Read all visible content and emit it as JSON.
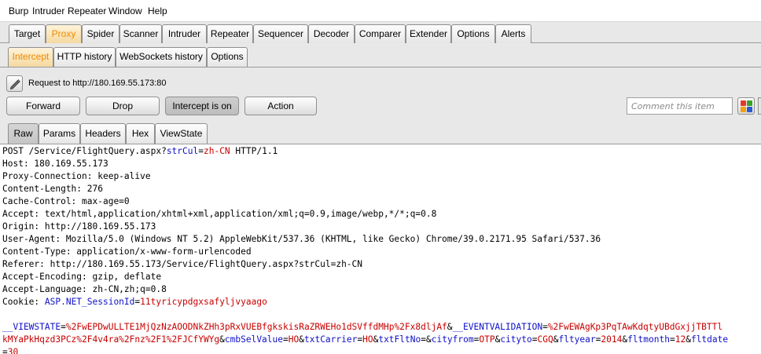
{
  "menu": [
    "Burp",
    "Intruder",
    "Repeater",
    "Window",
    "Help"
  ],
  "main_tabs": [
    "Target",
    "Proxy",
    "Spider",
    "Scanner",
    "Intruder",
    "Repeater",
    "Sequencer",
    "Decoder",
    "Comparer",
    "Extender",
    "Options",
    "Alerts"
  ],
  "main_tab_active": "Proxy",
  "proxy_tabs": [
    "Intercept",
    "HTTP history",
    "WebSockets history",
    "Options"
  ],
  "proxy_tab_active": "Intercept",
  "intercept": {
    "request_label": "Request to http://180.169.55.173:80",
    "forward_label": "Forward",
    "drop_label": "Drop",
    "intercept_label": "Intercept is on",
    "action_label": "Action",
    "comment_placeholder": "Comment this item"
  },
  "view_tabs": [
    "Raw",
    "Params",
    "Headers",
    "Hex",
    "ViewState"
  ],
  "view_tab_active": "Raw",
  "colors": {
    "accent_orange": "#f08a00",
    "param_blue": "#1010c8",
    "value_red": "#c80000"
  },
  "request": {
    "method_line": {
      "prefix": "POST /Service/FlightQuery.aspx?",
      "param": "strCul",
      "eq": "=",
      "value": "zh-CN",
      "suffix": " HTTP/1.1"
    },
    "headers": [
      "Host: 180.169.55.173",
      "Proxy-Connection: keep-alive",
      "Content-Length: 276",
      "Cache-Control: max-age=0",
      "Accept: text/html,application/xhtml+xml,application/xml;q=0.9,image/webp,*/*;q=0.8",
      "Origin: http://180.169.55.173",
      "User-Agent: Mozilla/5.0 (Windows NT 5.2) AppleWebKit/537.36 (KHTML, like Gecko) Chrome/39.0.2171.95 Safari/537.36",
      "Content-Type: application/x-www-form-urlencoded",
      "Referer: http://180.169.55.173/Service/FlightQuery.aspx?strCul=zh-CN",
      "Accept-Encoding: gzip, deflate",
      "Accept-Language: zh-CN,zh;q=0.8"
    ],
    "cookie": {
      "prefix": "Cookie: ",
      "name": "ASP.NET_SessionId",
      "eq": "=",
      "value": "11tyricypdgxsafyljvyaago"
    },
    "body_lines": [
      [
        {
          "t": "__VIEWSTATE",
          "c": "b"
        },
        {
          "t": "=",
          "c": "k"
        },
        {
          "t": "%2FwEPDwULLTE1MjQzNzAOODNkZHh3pRxVUEBfgkskisRaZRWEHo1dSVffdMHp%2Fx8dljAf",
          "c": "r"
        },
        {
          "t": "&",
          "c": "k"
        },
        {
          "t": "__EVENTVALIDATION",
          "c": "b"
        },
        {
          "t": "=",
          "c": "k"
        },
        {
          "t": "%2FwEWAgKp3PqTAwKdqtyUBdGxjjTBTTl",
          "c": "r"
        }
      ],
      [
        {
          "t": "kMYaPkHqzd3PCz%2F4v4ra%2Fnz%2F1%2FJCfYWYg",
          "c": "r"
        },
        {
          "t": "&",
          "c": "k"
        },
        {
          "t": "cmbSelValue",
          "c": "b"
        },
        {
          "t": "=",
          "c": "k"
        },
        {
          "t": "HO",
          "c": "r"
        },
        {
          "t": "&",
          "c": "k"
        },
        {
          "t": "txtCarrier",
          "c": "b"
        },
        {
          "t": "=",
          "c": "k"
        },
        {
          "t": "HO",
          "c": "r"
        },
        {
          "t": "&",
          "c": "k"
        },
        {
          "t": "txtFltNo",
          "c": "b"
        },
        {
          "t": "=",
          "c": "k"
        },
        {
          "t": "&",
          "c": "k"
        },
        {
          "t": "cityfrom",
          "c": "b"
        },
        {
          "t": "=",
          "c": "k"
        },
        {
          "t": "OTP",
          "c": "r"
        },
        {
          "t": "&",
          "c": "k"
        },
        {
          "t": "cityto",
          "c": "b"
        },
        {
          "t": "=",
          "c": "k"
        },
        {
          "t": "CGQ",
          "c": "r"
        },
        {
          "t": "&",
          "c": "k"
        },
        {
          "t": "fltyear",
          "c": "b"
        },
        {
          "t": "=",
          "c": "k"
        },
        {
          "t": "2014",
          "c": "r"
        },
        {
          "t": "&",
          "c": "k"
        },
        {
          "t": "fltmonth",
          "c": "b"
        },
        {
          "t": "=",
          "c": "k"
        },
        {
          "t": "12",
          "c": "r"
        },
        {
          "t": "&",
          "c": "k"
        },
        {
          "t": "fltdate",
          "c": "b"
        }
      ],
      [
        {
          "t": "=",
          "c": "k"
        },
        {
          "t": "30",
          "c": "r"
        }
      ]
    ]
  }
}
